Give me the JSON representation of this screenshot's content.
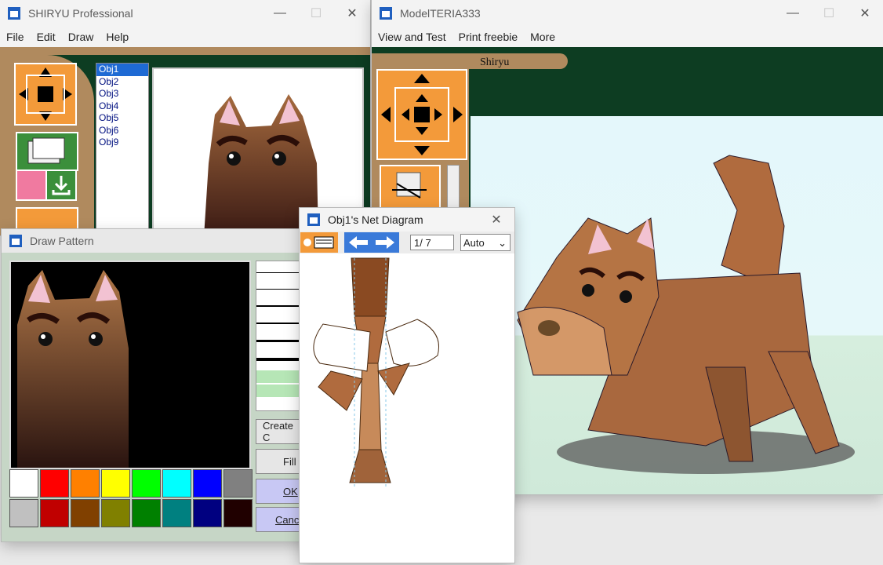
{
  "shiryu": {
    "title": "SHIRYU Professional",
    "menu": [
      "File",
      "Edit",
      "Draw",
      "Help"
    ],
    "objects": [
      "Obj1",
      "Obj2",
      "Obj3",
      "Obj4",
      "Obj5",
      "Obj6",
      "Obj9"
    ]
  },
  "model": {
    "title": "ModelTERIA333",
    "menu": [
      "View and Test",
      "Print freebie",
      "More"
    ],
    "label": "Shiryu",
    "swatches": [
      "#f4f4f4",
      "#f47a7a",
      "#f6f27a",
      "#86ee86",
      "#7e86f2",
      "pattern-black-yellow",
      "pattern-holo",
      "pattern-stone",
      "pattern-wood"
    ]
  },
  "draw_pattern": {
    "title": "Draw Pattern",
    "palette": [
      "#ffffff",
      "#ff0000",
      "#ff8000",
      "#ffff00",
      "#00ff00",
      "#00ffff",
      "#0000ff",
      "#808080",
      "#c0c0c0",
      "#c00000",
      "#804000",
      "#808000",
      "#008000",
      "#008080",
      "#000080",
      "#200000"
    ],
    "create_label": "Create C",
    "fill_label": "Fill",
    "ok_label": "OK",
    "cancel_label": "Canc"
  },
  "net": {
    "title": "Obj1's Net Diagram",
    "page": "1/ 7",
    "mode": "Auto"
  }
}
